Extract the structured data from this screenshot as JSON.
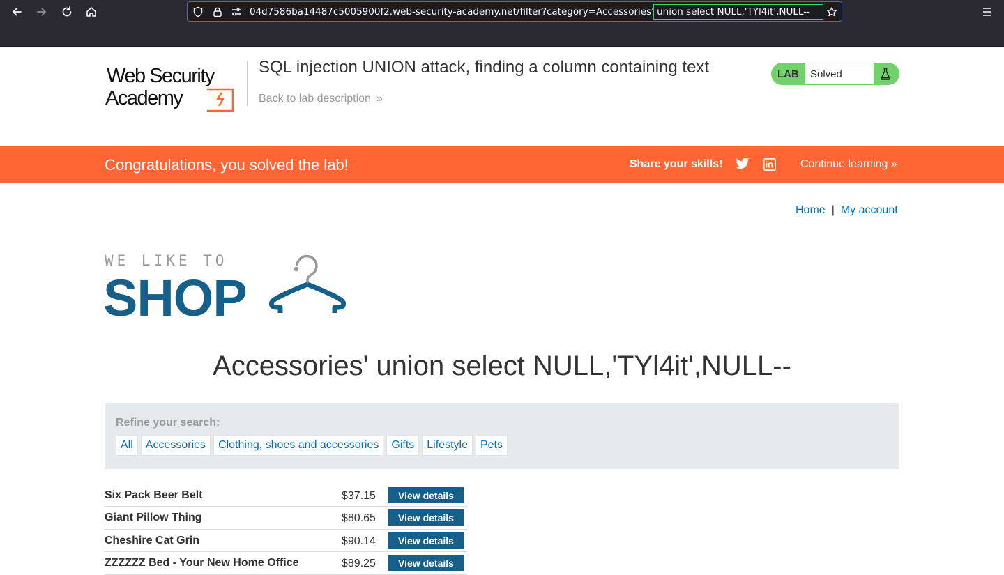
{
  "browser": {
    "url": "04d7586ba14487c5005900f2.web-security-academy.net/filter?category=Accessories' union select NULL,'TYl4it',NULL--",
    "icons": [
      "back-icon",
      "forward-icon",
      "reload-icon",
      "home-icon",
      "shield-icon",
      "lock-icon",
      "permissions-icon",
      "bookmark-star-icon",
      "menu-icon"
    ]
  },
  "lab": {
    "logo_text": [
      "Web Security",
      "Academy"
    ],
    "title": "SQL injection UNION attack, finding a column containing text",
    "back_link": "Back to lab description",
    "status_label": "LAB",
    "status_value": "Solved",
    "status_color": "#70d16d"
  },
  "banner": {
    "message": "Congratulations, you solved the lab!",
    "share": "Share your skills!",
    "continue": "Continue learning",
    "color": "#ff6633"
  },
  "nav": {
    "home": "Home",
    "separator": "|",
    "account": "My account"
  },
  "shop_logo": {
    "line1": "WE LIKE TO",
    "line2": "SHOP"
  },
  "page": {
    "heading": "Accessories' union select NULL,'TYl4it',NULL--"
  },
  "filters": {
    "label": "Refine your search:",
    "categories": [
      "All",
      "Accessories",
      "Clothing, shoes and accessories",
      "Gifts",
      "Lifestyle",
      "Pets"
    ]
  },
  "products": [
    {
      "name": "Six Pack Beer Belt",
      "price": "$37.15",
      "button": "View details"
    },
    {
      "name": "Giant Pillow Thing",
      "price": "$80.65",
      "button": "View details"
    },
    {
      "name": "Cheshire Cat Grin",
      "price": "$90.14",
      "button": "View details"
    },
    {
      "name": "ZZZZZZ Bed - Your New Home Office",
      "price": "$89.25",
      "button": "View details"
    }
  ]
}
